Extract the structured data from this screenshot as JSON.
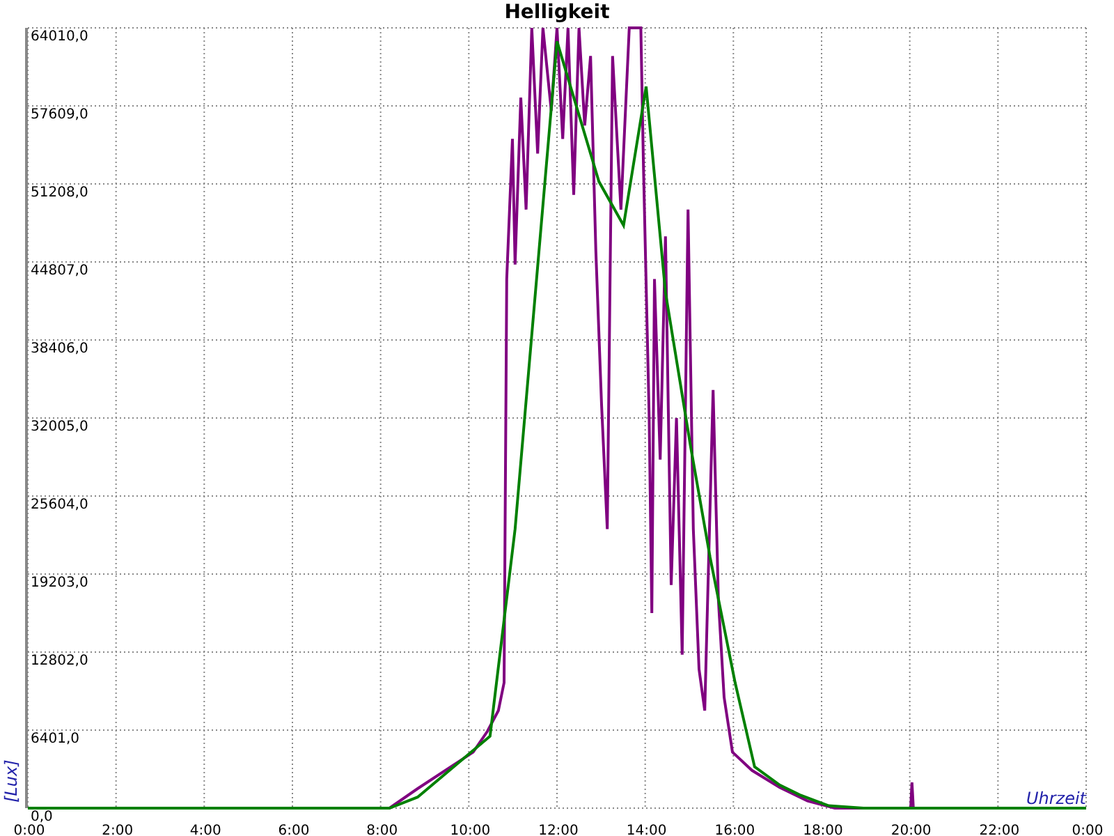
{
  "chart_data": {
    "type": "line",
    "title": "Helligkeit",
    "xlabel": "Uhrzeit",
    "ylabel": "[Lux]",
    "grid": true,
    "xlim": [
      0,
      24
    ],
    "ylim": [
      0,
      64010
    ],
    "xticks": [
      {
        "value": 0,
        "label": "0:00"
      },
      {
        "value": 2,
        "label": "2:00"
      },
      {
        "value": 4,
        "label": "4:00"
      },
      {
        "value": 6,
        "label": "6:00"
      },
      {
        "value": 8,
        "label": "8:00"
      },
      {
        "value": 10,
        "label": "10:00"
      },
      {
        "value": 12,
        "label": "12:00"
      },
      {
        "value": 14,
        "label": "14:00"
      },
      {
        "value": 16,
        "label": "16:00"
      },
      {
        "value": 18,
        "label": "18:00"
      },
      {
        "value": 20,
        "label": "20:00"
      },
      {
        "value": 22,
        "label": "22:00"
      },
      {
        "value": 24,
        "label": "0:00"
      }
    ],
    "yticks": [
      {
        "value": 0,
        "label": "0,0"
      },
      {
        "value": 6401,
        "label": "6401,0"
      },
      {
        "value": 12802,
        "label": "12802,0"
      },
      {
        "value": 19203,
        "label": "19203,0"
      },
      {
        "value": 25604,
        "label": "25604,0"
      },
      {
        "value": 32005,
        "label": "32005,0"
      },
      {
        "value": 38406,
        "label": "38406,0"
      },
      {
        "value": 44807,
        "label": "44807,0"
      },
      {
        "value": 51208,
        "label": "51208,0"
      },
      {
        "value": 57609,
        "label": "57609,0"
      },
      {
        "value": 64010,
        "label": "64010,0"
      }
    ],
    "series": [
      {
        "color": "#800080",
        "x": [
          0,
          8.2,
          8.84,
          10.1,
          10.42,
          10.67,
          10.8,
          10.86,
          10.99,
          11.05,
          11.18,
          11.3,
          11.43,
          11.56,
          11.68,
          11.87,
          12.0,
          12.13,
          12.25,
          12.38,
          12.5,
          12.63,
          12.76,
          12.88,
          13.01,
          13.14,
          13.26,
          13.45,
          13.64,
          13.9,
          13.96,
          14.09,
          14.15,
          14.21,
          14.34,
          14.46,
          14.59,
          14.71,
          14.84,
          14.97,
          15.09,
          15.22,
          15.35,
          15.54,
          15.66,
          15.79,
          15.98,
          16.42,
          17.05,
          17.68,
          18.3,
          20.02,
          20.05,
          20.08,
          24
        ],
        "values": [
          0,
          0,
          1600,
          4600,
          6300,
          8000,
          10300,
          43400,
          54900,
          44600,
          58300,
          49100,
          64010,
          53700,
          64010,
          57200,
          64010,
          54900,
          64010,
          50300,
          64010,
          56000,
          61700,
          45700,
          33100,
          22900,
          61700,
          49100,
          64010,
          64010,
          52600,
          32000,
          16000,
          43400,
          28600,
          46900,
          18300,
          32000,
          12600,
          49100,
          22900,
          11400,
          8000,
          34300,
          17100,
          9100,
          4600,
          3100,
          1700,
          600,
          0,
          0,
          2100,
          0,
          0
        ]
      },
      {
        "color": "#008000",
        "x": [
          0,
          8.2,
          8.84,
          10.48,
          11.05,
          12.0,
          12.95,
          13.51,
          14.02,
          14.46,
          15.03,
          15.47,
          16.04,
          16.48,
          17.05,
          17.5,
          18.16,
          18.95,
          24
        ],
        "values": [
          0,
          0,
          900,
          5900,
          22900,
          62900,
          51400,
          47800,
          59200,
          42300,
          29700,
          20600,
          10300,
          3400,
          1900,
          1100,
          200,
          0,
          0
        ]
      }
    ]
  }
}
